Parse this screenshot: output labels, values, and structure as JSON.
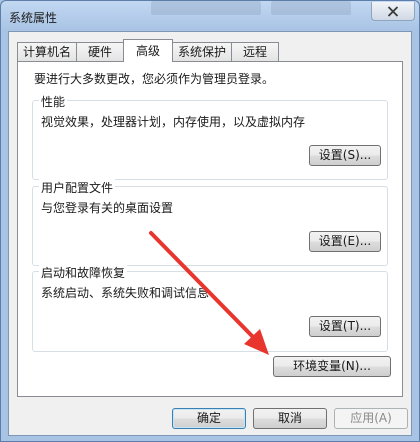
{
  "window": {
    "title": "系统属性"
  },
  "tabs": [
    {
      "label": "计算机名",
      "active": false
    },
    {
      "label": "硬件",
      "active": false
    },
    {
      "label": "高级",
      "active": true
    },
    {
      "label": "系统保护",
      "active": false
    },
    {
      "label": "远程",
      "active": false
    }
  ],
  "advanced": {
    "intro": "要进行大多数更改，您必须作为管理员登录。",
    "performance": {
      "label": "性能",
      "description": "视觉效果，处理器计划，内存使用，以及虚拟内存",
      "button": "设置(S)..."
    },
    "user_profiles": {
      "label": "用户配置文件",
      "description": "与您登录有关的桌面设置",
      "button": "设置(E)..."
    },
    "startup_recovery": {
      "label": "启动和故障恢复",
      "description": "系统启动、系统失败和调试信息",
      "button": "设置(T)..."
    },
    "env_button": "环境变量(N)..."
  },
  "footer": {
    "ok": "确定",
    "cancel": "取消",
    "apply": "应用(A)"
  },
  "colors": {
    "annotation_arrow": "#e8362e",
    "window_frame": "#a8c3e4"
  }
}
